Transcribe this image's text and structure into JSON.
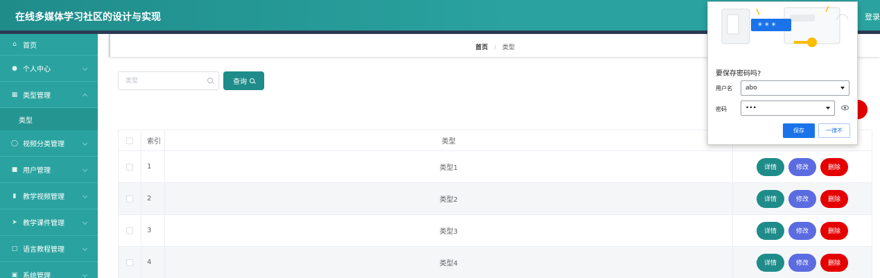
{
  "header": {
    "title": "在线多媒体学习社区的设计与实现",
    "login_label": "登录"
  },
  "sidebar": {
    "items": [
      {
        "label": "首页",
        "icon": "home-icon"
      },
      {
        "label": "个人中心",
        "icon": "user-icon"
      },
      {
        "label": "类型管理",
        "icon": "clipboard-icon",
        "sub": [
          {
            "label": "类型"
          }
        ]
      },
      {
        "label": "视频分类管理",
        "icon": "microphone-icon"
      },
      {
        "label": "用户管理",
        "icon": "group-icon"
      },
      {
        "label": "教学视频管理",
        "icon": "chart-icon"
      },
      {
        "label": "教学课件管理",
        "icon": "send-icon"
      },
      {
        "label": "语言教程管理",
        "icon": "crop-icon"
      },
      {
        "label": "系统管理",
        "icon": "settings-icon"
      }
    ]
  },
  "breadcrumb": {
    "home": "首页",
    "separator": "/",
    "current": "类型"
  },
  "search": {
    "placeholder": "类型",
    "value": "",
    "button_label": "查询"
  },
  "table": {
    "headers": {
      "index": "索引",
      "type": "类型"
    },
    "rows": [
      {
        "index": "1",
        "type": "类型1"
      },
      {
        "index": "2",
        "type": "类型2"
      },
      {
        "index": "3",
        "type": "类型3"
      },
      {
        "index": "4",
        "type": "类型4"
      }
    ],
    "actions": {
      "detail": "详情",
      "edit": "修改",
      "delete": "删除"
    }
  },
  "password_popup": {
    "question": "要保存密码吗?",
    "username_label": "用户名",
    "username_value": "abo",
    "password_label": "密码",
    "password_value": "•••",
    "illustration_text": "* * *",
    "save_label": "保存",
    "never_label": "一律不"
  },
  "colors": {
    "primary": "#1f8c8a",
    "sidebar": "#2aa3a0",
    "edit": "#5b6be0",
    "danger": "#e50000",
    "chrome_blue": "#1a73e8"
  }
}
